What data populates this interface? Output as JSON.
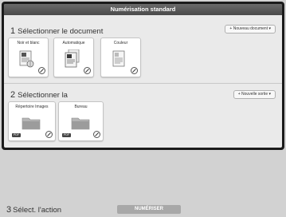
{
  "window": {
    "title": "Numérisation standard"
  },
  "section1": {
    "number": "1",
    "title": "Sélectionner le document",
    "new_button": "+ Nouveau document ▾",
    "cards": [
      {
        "label": "Noir et blanc",
        "icon": "bw-document-icon"
      },
      {
        "label": "Automatique",
        "icon": "auto-document-icon"
      },
      {
        "label": "Couleur",
        "icon": "color-document-icon"
      }
    ]
  },
  "section2": {
    "number": "2",
    "title": "Sélectionner la",
    "new_button": "+ Nouvelle sortie ▾",
    "cards": [
      {
        "label": "Répertoire Images",
        "tag": "PDF",
        "icon": "folder-icon"
      },
      {
        "label": "Bureau",
        "tag": "PDF",
        "icon": "folder-icon"
      }
    ]
  },
  "section3": {
    "number": "3",
    "title": "Sélect. l'action",
    "scan_button": "NUMÉRISER"
  }
}
